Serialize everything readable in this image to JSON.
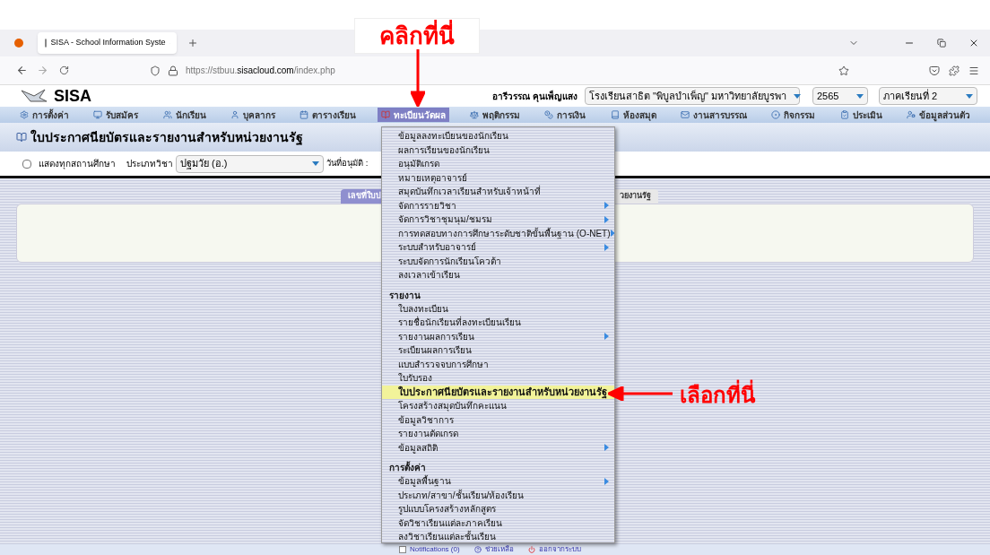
{
  "browser": {
    "tab_title": "SISA - School Information Syste",
    "url_prefix": "https://stbuu.",
    "url_domain": "sisacloud.com",
    "url_path": "/index.php"
  },
  "header": {
    "logo": "SISA",
    "user": "อารีวรรณ คุนเพ็ญแสง",
    "school": "โรงเรียนสาธิต \"พิบูลบำเพ็ญ\" มหาวิทยาลัยบูรพา",
    "year": "2565",
    "term": "ภาคเรียนที่ 2"
  },
  "nav": [
    {
      "label": "การตั้งค่า",
      "selected": false
    },
    {
      "label": "รับสมัคร",
      "selected": false
    },
    {
      "label": "นักเรียน",
      "selected": false
    },
    {
      "label": "บุคลากร",
      "selected": false
    },
    {
      "label": "ตารางเรียน",
      "selected": false
    },
    {
      "label": "ทะเบียนวัดผล",
      "selected": true
    },
    {
      "label": "พฤติกรรม",
      "selected": false
    },
    {
      "label": "การเงิน",
      "selected": false
    },
    {
      "label": "ห้องสมุด",
      "selected": false
    },
    {
      "label": "งานสารบรรณ",
      "selected": false
    },
    {
      "label": "กิจกรรม",
      "selected": false
    },
    {
      "label": "ประเมิน",
      "selected": false
    },
    {
      "label": "ข้อมูลส่วนตัว",
      "selected": false
    }
  ],
  "page_title": "ใบประกาศนียบัตรและรายงานสำหรับหน่วยงานรัฐ",
  "filters": {
    "show_all_label": "แสดงทุกสถานศึกษา",
    "show_all_checked": false,
    "subject_type_label": "ประเภทวิชา",
    "subject_type_value": "ปฐมวัย (อ.)",
    "approve_date_label": "วันที่อนุมัติ :"
  },
  "tabs": [
    {
      "label": "เลขที่ใบป",
      "selected": true
    },
    {
      "label": "วยงานรัฐ",
      "selected": false
    }
  ],
  "menu": [
    {
      "items": [
        {
          "label": "ข้อมูลลงทะเบียนของนักเรียน",
          "submenu": false,
          "selected": false
        },
        {
          "label": "ผลการเรียนของนักเรียน",
          "submenu": false,
          "selected": false
        },
        {
          "label": "อนุมัติเกรด",
          "submenu": false,
          "selected": false
        },
        {
          "label": "หมายเหตุอาจารย์",
          "submenu": false,
          "selected": false
        },
        {
          "label": "สมุดบันทึกเวลาเรียนสำหรับเจ้าหน้าที่",
          "submenu": false,
          "selected": false
        },
        {
          "label": "จัดการรายวิชา",
          "submenu": true,
          "selected": false
        },
        {
          "label": "จัดการวิชาชุมนุม/ชมรม",
          "submenu": true,
          "selected": false
        },
        {
          "label": "การทดสอบทางการศึกษาระดับชาติขั้นพื้นฐาน (O-NET)",
          "submenu": true,
          "selected": false
        },
        {
          "label": "ระบบสำหรับอาจารย์",
          "submenu": true,
          "selected": false
        },
        {
          "label": "ระบบจัดการนักเรียนโควต้า",
          "submenu": false,
          "selected": false
        },
        {
          "label": "ลงเวลาเข้าเรียน",
          "submenu": false,
          "selected": false
        }
      ]
    },
    {
      "header": "รายงาน",
      "items": [
        {
          "label": "ใบลงทะเบียน",
          "submenu": false,
          "selected": false
        },
        {
          "label": "รายชื่อนักเรียนที่ลงทะเบียนเรียน",
          "submenu": false,
          "selected": false
        },
        {
          "label": "รายงานผลการเรียน",
          "submenu": true,
          "selected": false
        },
        {
          "label": "ระเบียนผลการเรียน",
          "submenu": false,
          "selected": false
        },
        {
          "label": "แบบสำรวจจบการศึกษา",
          "submenu": false,
          "selected": false
        },
        {
          "label": "ใบรับรอง",
          "submenu": false,
          "selected": false
        },
        {
          "label": "ใบประกาศนียบัตรและรายงานสำหรับหน่วยงานรัฐ",
          "submenu": false,
          "selected": true
        },
        {
          "label": "โครงสร้างสมุดบันทึกคะแนน",
          "submenu": false,
          "selected": false
        },
        {
          "label": "ข้อมูลวิชาการ",
          "submenu": false,
          "selected": false
        },
        {
          "label": "รายงานตัดเกรด",
          "submenu": false,
          "selected": false
        },
        {
          "label": "ข้อมูลสถิติ",
          "submenu": true,
          "selected": false
        }
      ]
    },
    {
      "header": "การตั้งค่า",
      "items": [
        {
          "label": "ข้อมูลพื้นฐาน",
          "submenu": true,
          "selected": false
        },
        {
          "label": "ประเภท/สาขา/ชั้นเรียน/ห้องเรียน",
          "submenu": false,
          "selected": false
        },
        {
          "label": "รูปแบบโครงสร้างหลักสูตร",
          "submenu": false,
          "selected": false
        },
        {
          "label": "จัดวิชาเรียนแต่ละภาคเรียน",
          "submenu": false,
          "selected": false
        },
        {
          "label": "ลงวิชาเรียนแต่ละชั้นเรียน",
          "submenu": false,
          "selected": false
        }
      ]
    }
  ],
  "footer": {
    "notifications_checked": false,
    "notifications": "Notifications (0)",
    "help": "ช่วยเหลือ",
    "logout": "ออกจากระบบ"
  },
  "annotations": {
    "click_here": "คลิกที่นี่",
    "select_here": "เลือกที่นี่"
  }
}
